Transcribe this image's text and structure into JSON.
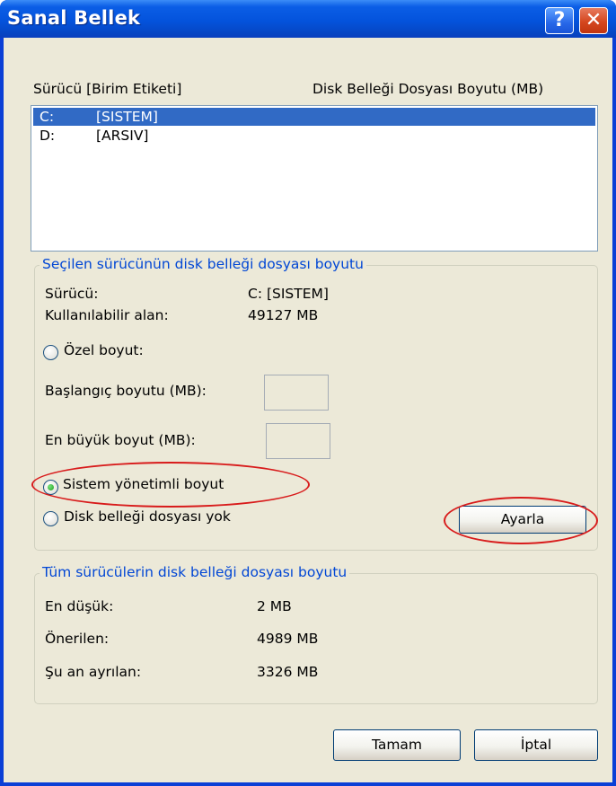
{
  "window": {
    "title": "Sanal Bellek",
    "help_glyph": "?",
    "close_glyph": "✕"
  },
  "list": {
    "header_drive": "Sürücü  [Birim Etiketi]",
    "header_size": "Disk Belleği Dosyası Boyutu (MB)",
    "rows": [
      {
        "drive": "C:",
        "label": "[SISTEM]",
        "selected": true
      },
      {
        "drive": "D:",
        "label": "[ARSIV]",
        "selected": false
      }
    ]
  },
  "selected_group": {
    "legend": "Seçilen sürücünün disk belleği dosyası boyutu",
    "drive_label": "Sürücü:",
    "drive_value": "C:  [SISTEM]",
    "free_label": "Kullanılabilir alan:",
    "free_value": "49127 MB",
    "custom_radio": "Özel boyut:",
    "initial_label": "Başlangıç boyutu (MB):",
    "initial_value": "",
    "max_label": "En büyük boyut (MB):",
    "max_value": "",
    "system_radio": "Sistem yönetimli boyut",
    "none_radio": "Disk belleği dosyası yok",
    "selected_option": "system",
    "set_button": "Ayarla"
  },
  "all_group": {
    "legend": "Tüm sürücülerin disk belleği dosyası boyutu",
    "min_label": "En düşük:",
    "min_value": "2 MB",
    "recommended_label": "Önerilen:",
    "recommended_value": "4989 MB",
    "allocated_label": "Şu an ayrılan:",
    "allocated_value": "3326 MB"
  },
  "buttons": {
    "ok": "Tamam",
    "cancel": "İptal"
  },
  "colors": {
    "title_bar": "#0453dc",
    "face": "#ece9d8",
    "selection": "#316ac5",
    "group_label": "#0046d5",
    "annotation": "#d81b1b"
  }
}
